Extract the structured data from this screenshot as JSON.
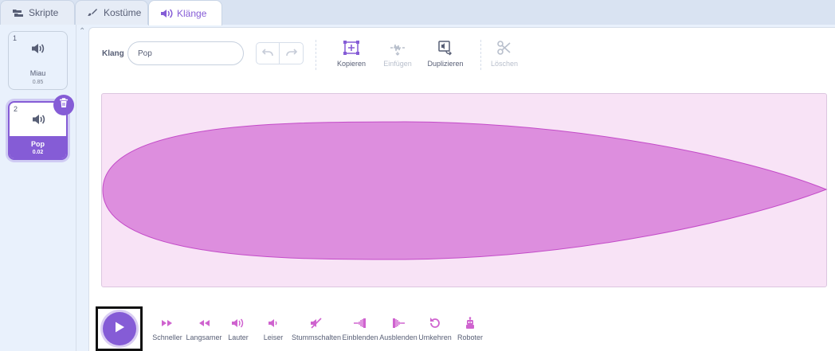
{
  "tabs": [
    {
      "label": "Skripte",
      "icon": "code-blocks-icon"
    },
    {
      "label": "Kostüme",
      "icon": "paintbrush-icon"
    },
    {
      "label": "Klänge",
      "icon": "speaker-icon"
    }
  ],
  "active_tab": "Klänge",
  "sounds": [
    {
      "index": "1",
      "name": "Miau",
      "duration": "0.85"
    },
    {
      "index": "2",
      "name": "Pop",
      "duration": "0.02"
    }
  ],
  "editor": {
    "name_label": "Klang",
    "name_value": "Pop",
    "tools": [
      {
        "label": "Kopieren",
        "icon": "copy-icon",
        "enabled": true
      },
      {
        "label": "Einfügen",
        "icon": "paste-icon",
        "enabled": false
      },
      {
        "label": "Duplizieren",
        "icon": "duplicate-icon",
        "enabled": true
      },
      {
        "label": "Löschen",
        "icon": "scissors-icon",
        "enabled": false
      }
    ]
  },
  "effects": [
    {
      "label": "Schneller",
      "icon": "faster-icon"
    },
    {
      "label": "Langsamer",
      "icon": "slower-icon"
    },
    {
      "label": "Lauter",
      "icon": "louder-icon"
    },
    {
      "label": "Leiser",
      "icon": "softer-icon"
    },
    {
      "label": "Stummschalten",
      "icon": "mute-icon"
    },
    {
      "label": "Einblenden",
      "icon": "fade-in-icon"
    },
    {
      "label": "Ausblenden",
      "icon": "fade-out-icon"
    },
    {
      "label": "Umkehren",
      "icon": "reverse-icon"
    },
    {
      "label": "Roboter",
      "icon": "robot-icon"
    }
  ],
  "colors": {
    "accent": "#855cd6",
    "waveform_fill": "#dd8ede",
    "waveform_background": "#f8e3f6",
    "effect_icon": "#cf63cf"
  }
}
